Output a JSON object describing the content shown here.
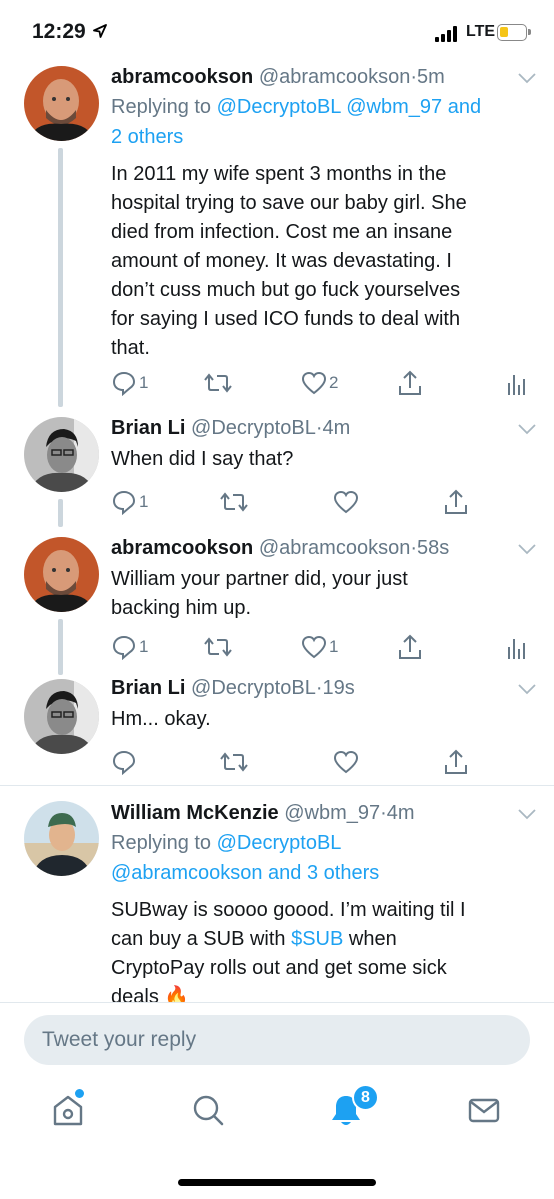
{
  "status_bar": {
    "time": "12:29",
    "network": "LTE"
  },
  "tweets": [
    {
      "name": "abramcookson",
      "handle": "@abramcookson",
      "sep": "·",
      "time": "5m",
      "replying_prefix": "Replying to",
      "replying_users": [
        "@DecryptoBL",
        "@wbm_97"
      ],
      "replying_and": "and",
      "replying_others": "2 others",
      "text_lines": [
        "In 2011 my wife spent 3 months in the",
        "hospital trying to save our baby girl. She",
        "died from infection. Cost me an insane",
        "amount of money. It was devastating. I",
        "don’t cuss much but go fuck yourselves",
        "for saying I used ICO funds to deal with",
        "that."
      ],
      "reply_count": "1",
      "like_count": "2"
    },
    {
      "name": "Brian Li",
      "handle": "@DecryptoBL",
      "sep": "·",
      "time": "4m",
      "text_lines": [
        "When did I say that?"
      ],
      "reply_count": "1"
    },
    {
      "name": "abramcookson",
      "handle": "@abramcookson",
      "sep": "·",
      "time": "58s",
      "text_lines": [
        "William your partner did, your just",
        "backing him up."
      ],
      "reply_count": "1",
      "like_count": "1"
    },
    {
      "name": "Brian Li",
      "handle": "@DecryptoBL",
      "sep": "·",
      "time": "19s",
      "text_lines": [
        "Hm... okay."
      ]
    },
    {
      "name": "William McKenzie",
      "handle": "@wbm_97",
      "sep": "·",
      "time": "4m",
      "replying_prefix": "Replying to",
      "replying_user": "@DecryptoBL",
      "replying_line2_user": "@abramcookson",
      "replying_line2_rest": "and 3 others",
      "text_line1": "SUBway is soooo goood. I’m waiting til I",
      "text_line2_pre": "can buy a SUB with",
      "text_cashtag": "$SUB",
      "text_line2_post": "when",
      "text_line3": "CryptoPay rolls out and get some sick",
      "text_line4": "deals",
      "emoji": "🔥"
    }
  ],
  "reply_bar": {
    "placeholder": "Tweet your reply"
  },
  "tab_bar": {
    "tabs": [
      "home-icon",
      "search-icon",
      "notifications-icon",
      "messages-icon"
    ],
    "notifications_badge": "8"
  },
  "colors": {
    "accent": "#1da1f2",
    "muted": "#657786",
    "thread_line": "#ccd6dd",
    "battery": "#f5c518"
  }
}
